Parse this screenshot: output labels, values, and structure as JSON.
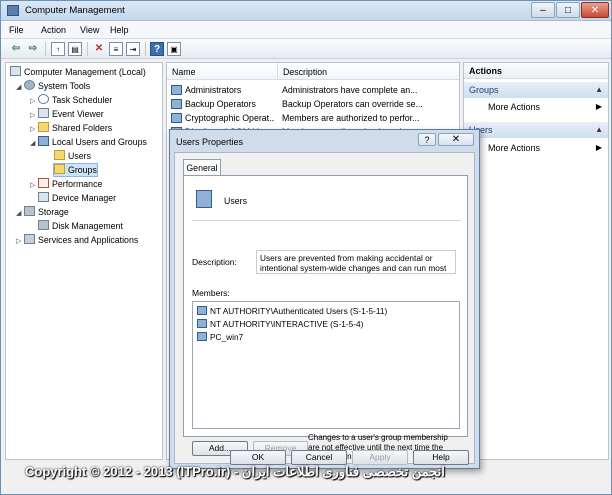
{
  "window": {
    "title": "Computer Management",
    "min": "–",
    "max": "□",
    "close": "✕"
  },
  "menu": [
    "File",
    "Action",
    "View",
    "Help"
  ],
  "tree": [
    {
      "label": "Computer Management (Local)",
      "icon": "computer-icon"
    },
    {
      "label": "System Tools",
      "icon": "tools-icon"
    },
    {
      "label": "Task Scheduler",
      "icon": "clock-icon"
    },
    {
      "label": "Event Viewer",
      "icon": "event-icon"
    },
    {
      "label": "Shared Folders",
      "icon": "folder-icon"
    },
    {
      "label": "Local Users and Groups",
      "icon": "users-icon"
    },
    {
      "label": "Users",
      "icon": "folder-icon"
    },
    {
      "label": "Groups",
      "icon": "folder-icon"
    },
    {
      "label": "Performance",
      "icon": "performance-icon"
    },
    {
      "label": "Device Manager",
      "icon": "device-icon"
    },
    {
      "label": "Storage",
      "icon": "storage-icon"
    },
    {
      "label": "Disk Management",
      "icon": "disk-icon"
    },
    {
      "label": "Services and Applications",
      "icon": "services-icon"
    }
  ],
  "list": {
    "col_name": "Name",
    "col_desc": "Description",
    "rows": [
      {
        "name": "Administrators",
        "desc": "Administrators have complete an..."
      },
      {
        "name": "Backup Operators",
        "desc": "Backup Operators can override se..."
      },
      {
        "name": "Cryptographic Operat...",
        "desc": "Members are authorized to perfor..."
      },
      {
        "name": "Distributed COM Users",
        "desc": "Members are allowed to launch, a..."
      }
    ]
  },
  "actions": {
    "header": "Actions",
    "section1": "Groups",
    "more1": "More Actions",
    "section2": "Users",
    "more2": "More Actions"
  },
  "dialog": {
    "title": "Users Properties",
    "help": "?",
    "close": "✕",
    "tab": "General",
    "group_name": "Users",
    "desc_label": "Description:",
    "desc_value": "Users are prevented from making accidental or intentional system-wide changes and can run most",
    "members_label": "Members:",
    "members": [
      "NT AUTHORITY\\Authenticated Users (S-1-5-11)",
      "NT AUTHORITY\\INTERACTIVE (S-1-5-4)",
      "PC_win7"
    ],
    "add": "Add...",
    "remove": "Remove",
    "note": "Changes to a user's group membership are not effective until the next time the user logs on.",
    "ok": "OK",
    "cancel": "Cancel",
    "apply": "Apply",
    "help_btn": "Help"
  },
  "footer": "Copyright © 2012 - 2013 (ITPro.ir) - انجمن تخصصی فناوری اطلاعات ایران"
}
